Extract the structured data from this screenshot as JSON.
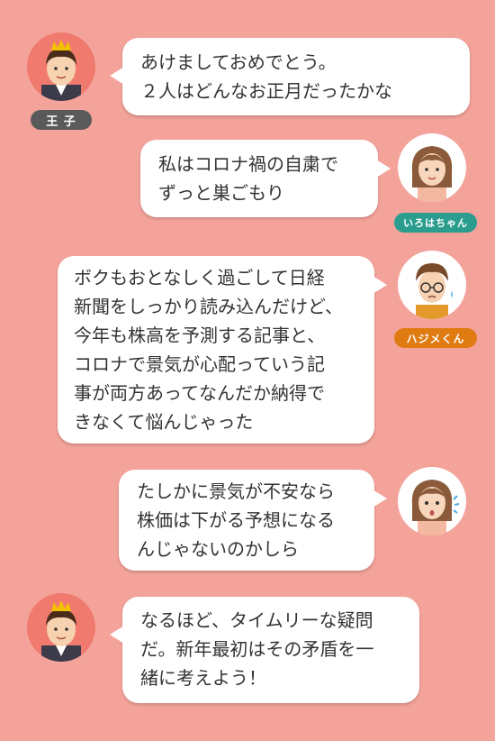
{
  "speakers": {
    "prince": "王 子",
    "iroha": "いろはちゃん",
    "hajime": "ハジメくん"
  },
  "messages": [
    {
      "speaker": "prince",
      "text": "あけましておめでとう。\n２人はどんなお正月だったかな"
    },
    {
      "speaker": "iroha",
      "text": "私はコロナ禍の自粛で\nずっと巣ごもり"
    },
    {
      "speaker": "hajime",
      "text": "ボクもおとなしく過ごして日経\n新聞をしっかり読み込んだけど、\n今年も株高を予測する記事と、\nコロナで景気が心配っていう記\n事が両方あってなんだか納得で\nきなくて悩んじゃった"
    },
    {
      "speaker": "iroha",
      "text": "たしかに景気が不安なら\n株価は下がる予想になる\nんじゃないのかしら"
    },
    {
      "speaker": "prince",
      "text": "なるほど、タイムリーな疑問\nだ。新年最初はその矛盾を一\n緒に考えよう！"
    }
  ],
  "colors": {
    "background": "#f4a39b",
    "prince_tag": "#5a5a5a",
    "iroha_tag": "#2a9d8f",
    "hajime_tag": "#e07b12"
  }
}
